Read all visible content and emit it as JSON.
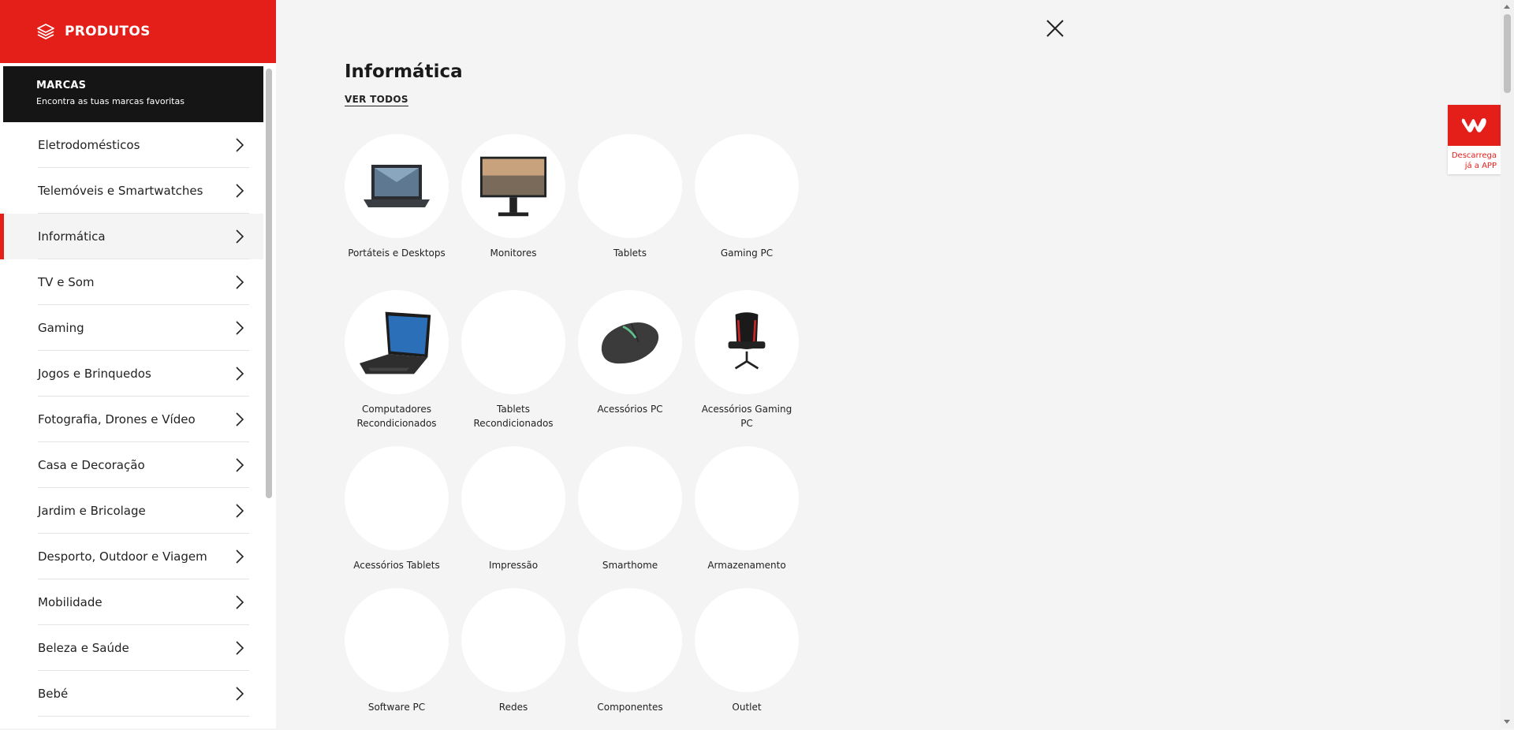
{
  "sidebar": {
    "header_title": "PRODUTOS",
    "brands": {
      "title": "MARCAS",
      "subtitle": "Encontra as tuas marcas favoritas"
    },
    "items": [
      {
        "label": "Eletrodomésticos"
      },
      {
        "label": "Telemóveis e Smartwatches"
      },
      {
        "label": "Informática",
        "active": true
      },
      {
        "label": "TV e Som"
      },
      {
        "label": "Gaming"
      },
      {
        "label": "Jogos e Brinquedos"
      },
      {
        "label": "Fotografia, Drones e Vídeo"
      },
      {
        "label": "Casa e Decoração"
      },
      {
        "label": "Jardim e Bricolage"
      },
      {
        "label": "Desporto, Outdoor e Viagem"
      },
      {
        "label": "Mobilidade"
      },
      {
        "label": "Beleza e Saúde"
      },
      {
        "label": "Bebé"
      }
    ]
  },
  "main": {
    "title": "Informática",
    "see_all": "VER TODOS",
    "tiles": [
      {
        "label": "Portáteis e Desktops",
        "icon": "laptop-image"
      },
      {
        "label": "Monitores",
        "icon": "monitor-image"
      },
      {
        "label": "Tablets",
        "icon": ""
      },
      {
        "label": "Gaming PC",
        "icon": ""
      },
      {
        "label": "Computadores Recondicionados",
        "icon": "refurbished-laptop-image"
      },
      {
        "label": "Tablets Recondicionados",
        "icon": ""
      },
      {
        "label": "Acessórios PC",
        "icon": "mouse-image"
      },
      {
        "label": "Acessórios Gaming PC",
        "icon": "gaming-chair-image"
      },
      {
        "label": "Acessórios Tablets",
        "icon": ""
      },
      {
        "label": "Impressão",
        "icon": ""
      },
      {
        "label": "Smarthome",
        "icon": ""
      },
      {
        "label": "Armazenamento",
        "icon": ""
      },
      {
        "label": "Software PC",
        "icon": ""
      },
      {
        "label": "Redes",
        "icon": ""
      },
      {
        "label": "Componentes",
        "icon": ""
      },
      {
        "label": "Outlet",
        "icon": ""
      }
    ]
  },
  "app_badge": {
    "line1": "Descarrega",
    "line2": "já a APP"
  },
  "colors": {
    "accent": "#e41e18",
    "dark": "#151515",
    "background": "#f4f4f4"
  }
}
